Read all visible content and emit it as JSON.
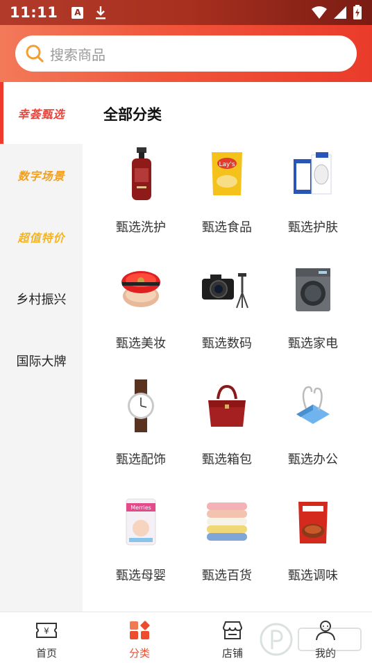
{
  "status_bar": {
    "time": "11:11",
    "a_badge": "A"
  },
  "search": {
    "placeholder": "搜索商品"
  },
  "sidebar": {
    "items": [
      {
        "label": "幸荟甄选",
        "color": "#e8433a",
        "active": true
      },
      {
        "label": "数字场景",
        "color": "#f0a020",
        "active": false
      },
      {
        "label": "超值特价",
        "color": "#f5b520",
        "active": false
      },
      {
        "label": "乡村振兴",
        "color": "#222222",
        "active": false
      },
      {
        "label": "国际大牌",
        "color": "#222222",
        "active": false
      }
    ]
  },
  "main": {
    "title": "全部分类",
    "categories": [
      {
        "label": "甄选洗护",
        "icon": "shampoo-bottle-icon"
      },
      {
        "label": "甄选食品",
        "icon": "chips-bag-icon"
      },
      {
        "label": "甄选护肤",
        "icon": "face-mask-box-icon"
      },
      {
        "label": "甄选美妆",
        "icon": "cushion-compact-icon"
      },
      {
        "label": "甄选数码",
        "icon": "camera-icon"
      },
      {
        "label": "甄选家电",
        "icon": "washing-machine-icon"
      },
      {
        "label": "甄选配饰",
        "icon": "wristwatch-icon"
      },
      {
        "label": "甄选箱包",
        "icon": "handbag-icon"
      },
      {
        "label": "甄选办公",
        "icon": "binder-clip-icon"
      },
      {
        "label": "甄选母婴",
        "icon": "diaper-pack-icon"
      },
      {
        "label": "甄选百货",
        "icon": "towel-stack-icon"
      },
      {
        "label": "甄选调味",
        "icon": "seasoning-packet-icon"
      }
    ]
  },
  "bottom_nav": {
    "items": [
      {
        "label": "首页",
        "icon": "ticket-yen-icon",
        "active": false
      },
      {
        "label": "分类",
        "icon": "category-grid-icon",
        "active": true
      },
      {
        "label": "店铺",
        "icon": "store-icon",
        "active": false
      },
      {
        "label": "我的",
        "icon": "user-icon",
        "active": false
      }
    ]
  },
  "colors": {
    "accent": "#ee3b2b",
    "header_start": "#f27a5a",
    "header_end": "#ea3b2a"
  }
}
